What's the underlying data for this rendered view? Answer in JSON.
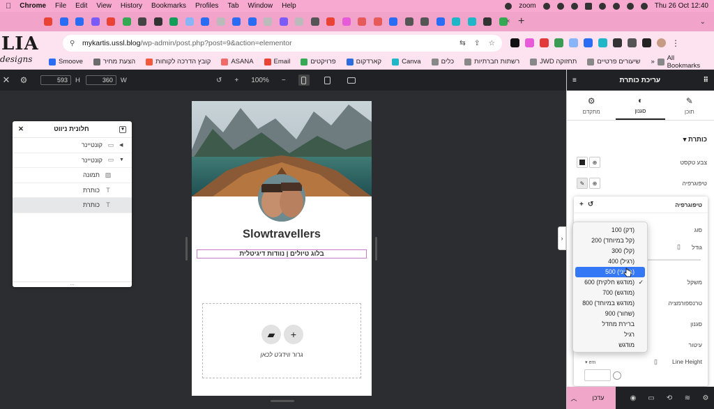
{
  "mac_menu": {
    "app": "Chrome",
    "items": [
      "File",
      "Edit",
      "View",
      "History",
      "Bookmarks",
      "Profiles",
      "Tab",
      "Window",
      "Help"
    ],
    "status_zoom": "zoom",
    "clock": "Thu 26 Oct  12:40"
  },
  "logo": {
    "big": "LIA",
    "small": "designs"
  },
  "browser": {
    "url_host": "mykartis.ussl.blog",
    "url_path": "/wp-admin/post.php?post=9&action=elementor"
  },
  "bookmarks": [
    {
      "label": "Smoove",
      "color": "#2a6df4"
    },
    {
      "label": "הצעת מחיר",
      "color": "#6b6b6b"
    },
    {
      "label": "קובץ הדרכה לקוחות",
      "color": "#f3583a"
    },
    {
      "label": "ASANA",
      "color": "#f06a6a"
    },
    {
      "label": "Email",
      "color": "#ea4335"
    },
    {
      "label": "פרויקטים",
      "color": "#34a853"
    },
    {
      "label": "קארדקום",
      "color": "#2d6cdf"
    },
    {
      "label": "Canva",
      "color": "#1fb6c8"
    },
    {
      "label": "כלים",
      "color": "#888888"
    },
    {
      "label": "רשתות חברתיות",
      "color": "#888888"
    },
    {
      "label": "JWD תחזוקה",
      "color": "#888888"
    },
    {
      "label": "שיעורים פרטיים",
      "color": "#888888"
    }
  ],
  "bookmarks_all": "All Bookmarks",
  "toolbar": {
    "width_value": "593",
    "height_label": "H",
    "height_value": "360",
    "width_label": "W",
    "zoom": "100%"
  },
  "navigator": {
    "title": "חלונית ניווט",
    "items": [
      {
        "label": "קונטיינר",
        "icon": "container-icon"
      },
      {
        "label": "קונטיינר",
        "icon": "container-icon"
      },
      {
        "label": "תמונה",
        "icon": "image-icon"
      },
      {
        "label": "כותרת",
        "icon": "heading-icon"
      },
      {
        "label": "כותרת",
        "icon": "heading-icon"
      }
    ]
  },
  "preview": {
    "title": "Slowtravellers",
    "subtitle": "בלוג טיולים | נוודות דיגיטלית",
    "drop_text": "גרור ווידג'ט לכאן"
  },
  "panel": {
    "header": "עריכת כותרת",
    "tabs": [
      {
        "label": "תוכן",
        "icon": "pencil-icon"
      },
      {
        "label": "סגנון",
        "icon": "contrast-icon"
      },
      {
        "label": "מתקדם",
        "icon": "gear-icon"
      }
    ],
    "section": "כותרת",
    "text_color": "צבע טקסט",
    "typography": "טיפוגרפיה",
    "popover_title": "טיפוגרפיה",
    "labels": {
      "family": "סוג",
      "size": "גודל",
      "weight": "משקל",
      "transform": "טרנספורמציה",
      "style": "סגנון",
      "decoration": "עיטור",
      "line_height": "Line Height",
      "unit": "em"
    },
    "publish": "עדכן"
  },
  "weight_dropdown": {
    "options": [
      "100 (דק)",
      "200 (קל במיוחד)",
      "300 (קל)",
      "400 (רגיל)",
      "500 (בינוני)",
      "600 (מודגש חלקית)",
      "700 (מודגש)",
      "800 (מודגש במיוחד)",
      "900 (שחור)",
      "ברירת מחדל",
      "רגיל",
      "מודגש"
    ],
    "highlighted": "500 (בינוני)",
    "checked": "600 (מודגש חלקית)"
  },
  "colors": {
    "menubar": "#f7a9cf",
    "elementor_dark": "#1f2124",
    "accent_pink": "#f0a6c8",
    "selection_blue": "#3478f6"
  }
}
